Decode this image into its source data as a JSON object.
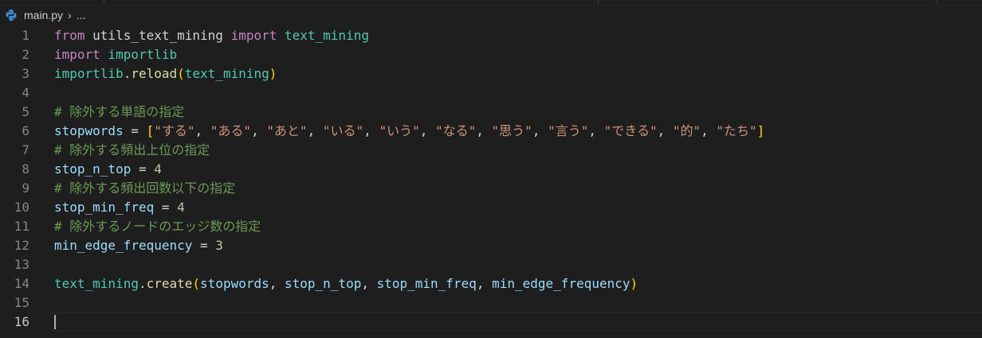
{
  "breadcrumb": {
    "file": "main.py",
    "sep": "›",
    "more": "..."
  },
  "editor": {
    "active_line": 16,
    "lines": [
      {
        "n": "1",
        "tokens": [
          {
            "t": "from",
            "c": "kw"
          },
          {
            "t": " utils_text_mining ",
            "c": "pn"
          },
          {
            "t": "import",
            "c": "kw"
          },
          {
            "t": " ",
            "c": "pn"
          },
          {
            "t": "text_mining",
            "c": "mod"
          }
        ]
      },
      {
        "n": "2",
        "tokens": [
          {
            "t": "import",
            "c": "kw"
          },
          {
            "t": " ",
            "c": "pn"
          },
          {
            "t": "importlib",
            "c": "mod"
          }
        ]
      },
      {
        "n": "3",
        "tokens": [
          {
            "t": "importlib",
            "c": "mod"
          },
          {
            "t": ".",
            "c": "pn"
          },
          {
            "t": "reload",
            "c": "fn"
          },
          {
            "t": "(",
            "c": "br1"
          },
          {
            "t": "text_mining",
            "c": "mod"
          },
          {
            "t": ")",
            "c": "br1"
          }
        ]
      },
      {
        "n": "4",
        "tokens": []
      },
      {
        "n": "5",
        "tokens": [
          {
            "t": "# 除外する単語の指定",
            "c": "cm"
          }
        ]
      },
      {
        "n": "6",
        "tokens": [
          {
            "t": "stopwords",
            "c": "var"
          },
          {
            "t": " = ",
            "c": "pn"
          },
          {
            "t": "[",
            "c": "br1"
          },
          {
            "t": "\"する\"",
            "c": "str"
          },
          {
            "t": ", ",
            "c": "pn"
          },
          {
            "t": "\"ある\"",
            "c": "str"
          },
          {
            "t": ", ",
            "c": "pn"
          },
          {
            "t": "\"あと\"",
            "c": "str"
          },
          {
            "t": ", ",
            "c": "pn"
          },
          {
            "t": "\"いる\"",
            "c": "str"
          },
          {
            "t": ", ",
            "c": "pn"
          },
          {
            "t": "\"いう\"",
            "c": "str"
          },
          {
            "t": ", ",
            "c": "pn"
          },
          {
            "t": "\"なる\"",
            "c": "str"
          },
          {
            "t": ", ",
            "c": "pn"
          },
          {
            "t": "\"思う\"",
            "c": "str"
          },
          {
            "t": ", ",
            "c": "pn"
          },
          {
            "t": "\"言う\"",
            "c": "str"
          },
          {
            "t": ", ",
            "c": "pn"
          },
          {
            "t": "\"できる\"",
            "c": "str"
          },
          {
            "t": ", ",
            "c": "pn"
          },
          {
            "t": "\"的\"",
            "c": "str"
          },
          {
            "t": ", ",
            "c": "pn"
          },
          {
            "t": "\"たち\"",
            "c": "str"
          },
          {
            "t": "]",
            "c": "br1"
          }
        ]
      },
      {
        "n": "7",
        "tokens": [
          {
            "t": "# 除外する頻出上位の指定",
            "c": "cm"
          }
        ]
      },
      {
        "n": "8",
        "tokens": [
          {
            "t": "stop_n_top",
            "c": "var"
          },
          {
            "t": " = ",
            "c": "pn"
          },
          {
            "t": "4",
            "c": "num"
          }
        ]
      },
      {
        "n": "9",
        "tokens": [
          {
            "t": "# 除外する頻出回数以下の指定",
            "c": "cm"
          }
        ]
      },
      {
        "n": "10",
        "tokens": [
          {
            "t": "stop_min_freq",
            "c": "var"
          },
          {
            "t": " = ",
            "c": "pn"
          },
          {
            "t": "4",
            "c": "num"
          }
        ]
      },
      {
        "n": "11",
        "tokens": [
          {
            "t": "# 除外するノードのエッジ数の指定",
            "c": "cm"
          }
        ]
      },
      {
        "n": "12",
        "tokens": [
          {
            "t": "min_edge_frequency",
            "c": "var"
          },
          {
            "t": " = ",
            "c": "pn"
          },
          {
            "t": "3",
            "c": "num"
          }
        ]
      },
      {
        "n": "13",
        "tokens": []
      },
      {
        "n": "14",
        "tokens": [
          {
            "t": "text_mining",
            "c": "mod"
          },
          {
            "t": ".",
            "c": "pn"
          },
          {
            "t": "create",
            "c": "fn"
          },
          {
            "t": "(",
            "c": "br1"
          },
          {
            "t": "stopwords",
            "c": "var"
          },
          {
            "t": ", ",
            "c": "pn"
          },
          {
            "t": "stop_n_top",
            "c": "var"
          },
          {
            "t": ", ",
            "c": "pn"
          },
          {
            "t": "stop_min_freq",
            "c": "var"
          },
          {
            "t": ", ",
            "c": "pn"
          },
          {
            "t": "min_edge_frequency",
            "c": "var"
          },
          {
            "t": ")",
            "c": "br1"
          }
        ]
      },
      {
        "n": "15",
        "tokens": []
      },
      {
        "n": "16",
        "tokens": []
      }
    ]
  }
}
